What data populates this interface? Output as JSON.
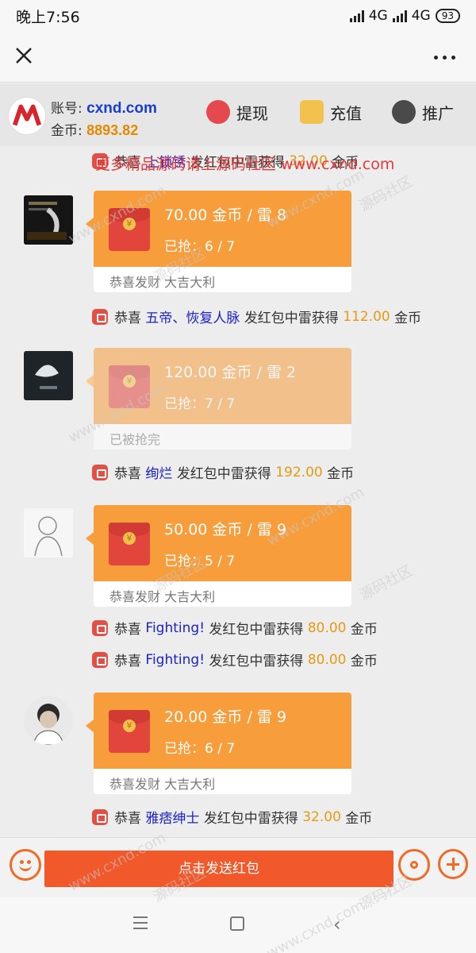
{
  "statusbar": {
    "time": "晚上7:56",
    "net1": "4G",
    "net2": "4G",
    "battery": "93"
  },
  "header": {
    "account_label": "账号:",
    "account_value": "cxnd.com",
    "coins_label": "金币:",
    "coins_value": "8893.82",
    "withdraw": "提现",
    "recharge": "充值",
    "promote": "推广"
  },
  "promo_text": "更多精品源码请上源码社区 www.cxnd.com",
  "feed": {
    "notice0": {
      "pre": "恭喜",
      "name": "上锁锈",
      "mid": "发红包中雷获得",
      "amount": "32.00",
      "unit": "金币"
    },
    "packet1": {
      "title": "70.00 金币 / 雷 8",
      "grab": "已抢：6 / 7",
      "foot": "恭喜发财 大吉大利"
    },
    "notice1": {
      "pre": "恭喜",
      "name": "五帝、恢复人脉",
      "mid": "发红包中雷获得",
      "amount": "112.00",
      "unit": "金币"
    },
    "packet2": {
      "title": "120.00 金币 / 雷 2",
      "grab": "已抢：7 / 7",
      "foot": "已被抢完"
    },
    "notice2": {
      "pre": "恭喜",
      "name": "绚烂",
      "mid": "发红包中雷获得",
      "amount": "192.00",
      "unit": "金币"
    },
    "packet3": {
      "title": "50.00 金币 / 雷 9",
      "grab": "已抢：5 / 7",
      "foot": "恭喜发财 大吉大利"
    },
    "notice3": {
      "pre": "恭喜",
      "name": "Fighting!",
      "mid": "发红包中雷获得",
      "amount": "80.00",
      "unit": "金币"
    },
    "notice4": {
      "pre": "恭喜",
      "name": "Fighting!",
      "mid": "发红包中雷获得",
      "amount": "80.00",
      "unit": "金币"
    },
    "packet4": {
      "title": "20.00 金币 / 雷 9",
      "grab": "已抢：6 / 7",
      "foot": "恭喜发财 大吉大利"
    },
    "notice5": {
      "pre": "恭喜",
      "name": "雅痞绅士",
      "mid": "发红包中雷获得",
      "amount": "32.00",
      "unit": "金币"
    },
    "coin_symbol": "¥"
  },
  "bottom": {
    "send_label": "点击发送红包"
  },
  "watermark": {
    "latin": "www.cxnd.com",
    "cjk": "源码社区"
  },
  "colors": {
    "accent": "#f1582a",
    "packet": "#f79d3b",
    "name": "#1c22c9",
    "amount": "#e49a12"
  }
}
